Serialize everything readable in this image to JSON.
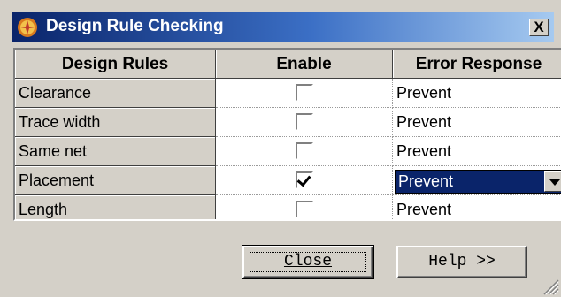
{
  "window": {
    "title": "Design Rule Checking",
    "close_glyph": "X"
  },
  "table": {
    "headers": [
      "Design Rules",
      "Enable",
      "Error Response"
    ],
    "rows": [
      {
        "rule": "Clearance",
        "enabled": false,
        "response": "Prevent"
      },
      {
        "rule": "Trace width",
        "enabled": false,
        "response": "Prevent"
      },
      {
        "rule": "Same net",
        "enabled": false,
        "response": "Prevent"
      },
      {
        "rule": "Placement",
        "enabled": true,
        "response": "Prevent"
      },
      {
        "rule": "Length",
        "enabled": false,
        "response": "Prevent"
      }
    ]
  },
  "buttons": {
    "close": "Close",
    "help": "Help >>"
  },
  "colors": {
    "title_start": "#0a246a",
    "title_end": "#a6caf0",
    "selection": "#0a246a",
    "face": "#d4d0c8"
  },
  "icons": {
    "app": "fire-wheel-icon",
    "close": "close-icon",
    "dropdown": "chevron-down-icon",
    "grip": "resize-grip-icon"
  }
}
